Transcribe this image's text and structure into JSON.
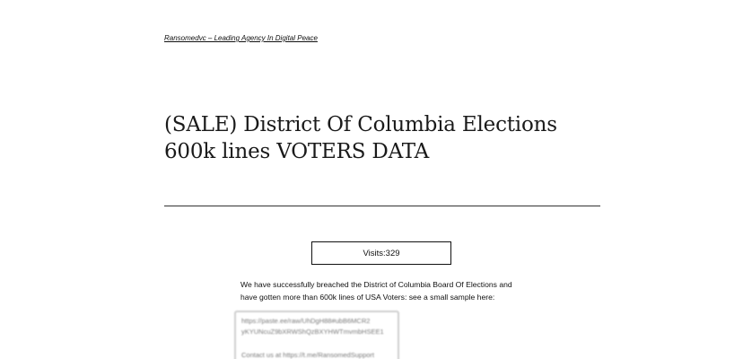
{
  "site": {
    "title": "Ransomedvc – Leading Agency In Digital Peace"
  },
  "post": {
    "title": "(SALE) District Of Columbia Elections 600k lines VOTERS DATA",
    "visits_label": "Visits:",
    "visits_count": "329",
    "intro_line_1": "We have successfully breached the District of Columbia Board Of Elections and",
    "intro_line_2": "have gotten more than 600k lines of USA Voters: see a small sample here:",
    "sample": {
      "line_1": "https://paste.ee/raw/UhDgH88#ubB6MCR2",
      "line_2": "yKYUNcuZ9bXRWShQzBXYHWTmvmbHSEE1",
      "line_3": "Contact us at https://t.me/RansomedSupport"
    }
  }
}
